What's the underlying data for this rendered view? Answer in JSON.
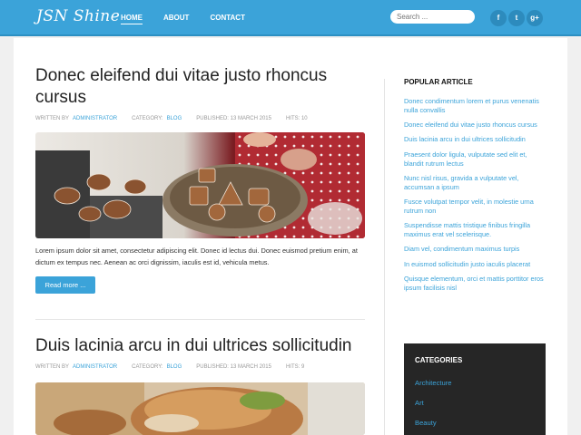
{
  "header": {
    "logo": "JSN Shine",
    "nav": [
      "HOME",
      "ABOUT",
      "CONTACT"
    ],
    "search_placeholder": "Search ...",
    "social": [
      {
        "name": "facebook-icon",
        "glyph": "f"
      },
      {
        "name": "twitter-icon",
        "glyph": "t"
      },
      {
        "name": "google-plus-icon",
        "glyph": "g+"
      }
    ]
  },
  "posts": [
    {
      "title": "Donec eleifend dui vitae justo rhoncus cursus",
      "meta": {
        "written_by_label": "WRITTEN BY",
        "author": "ADMINISTRATOR",
        "category_label": "CATEGORY:",
        "category": "BLOG",
        "published": "PUBLISHED: 13 MARCH 2015",
        "hits": "HITS: 10"
      },
      "image": "gingerbread-cookies-photo",
      "excerpt": "Lorem ipsum dolor sit amet, consectetur adipiscing elit. Donec id lectus dui. Donec euismod pretium enim, at dictum ex tempus nec. Aenean ac orci dignissim, iaculis est id, vehicula metus.",
      "read_more": "Read more ..."
    },
    {
      "title": "Duis lacinia arcu in dui ultrices sollicitudin",
      "meta": {
        "written_by_label": "WRITTEN BY",
        "author": "ADMINISTRATOR",
        "category_label": "CATEGORY:",
        "category": "BLOG",
        "published": "PUBLISHED: 13 MARCH 2015",
        "hits": "HITS: 9"
      },
      "image": "sandwich-photo"
    }
  ],
  "sidebar": {
    "popular_heading": "POPULAR ARTICLE",
    "popular": [
      "Donec condimentum lorem et purus venenatis nulla convallis",
      "Donec eleifend dui vitae justo rhoncus cursus",
      "Duis lacinia arcu in dui ultrices sollicitudin",
      "Praesent dolor ligula, vulputate sed elit et, blandit rutrum lectus",
      "Nunc nisl risus, gravida a vulputate vel, accumsan a ipsum",
      "Fusce volutpat tempor velit, in molestie urna rutrum non",
      "Suspendisse mattis tristique finibus fringilla maximus erat vel scelerisque.",
      "Diam vel, condimentum maximus turpis",
      "In euismod sollicitudin justo iaculis placerat",
      "Quisque elementum, orci et mattis porttitor eros ipsum facilisis nisl"
    ],
    "categories_heading": "CATEGORIES",
    "categories": [
      "Architecture",
      "Art",
      "Beauty"
    ]
  },
  "colors": {
    "accent": "#3ba3d9",
    "header_bg": "#3ba3d9",
    "category_box_bg": "#262626"
  }
}
